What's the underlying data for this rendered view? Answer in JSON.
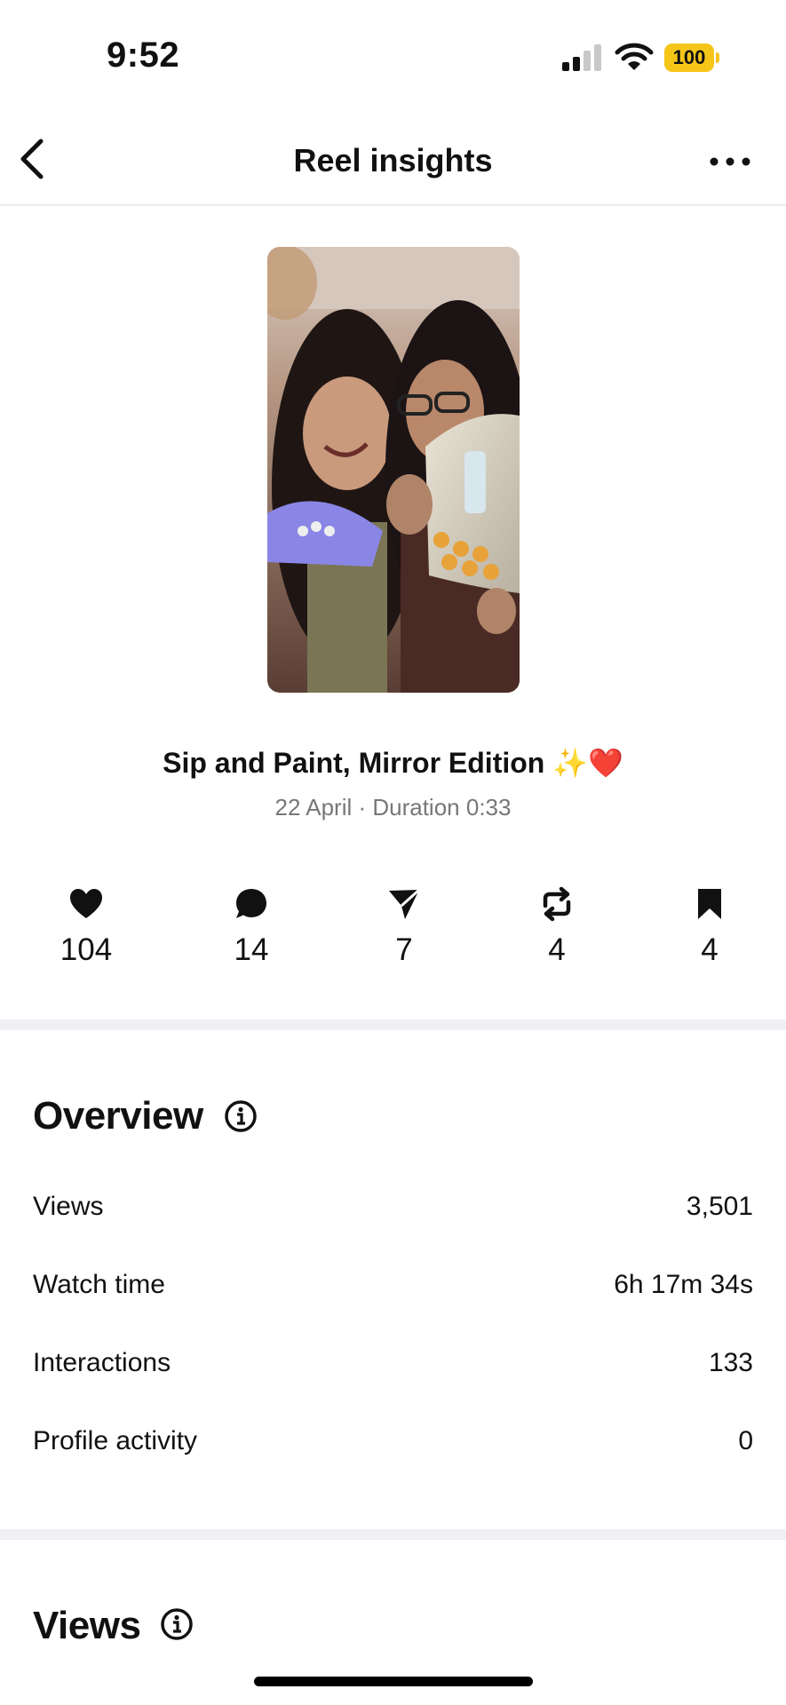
{
  "status_bar": {
    "time": "9:52",
    "battery": "100"
  },
  "nav": {
    "title": "Reel insights"
  },
  "reel": {
    "caption": "Sip and Paint, Mirror Edition ✨❤️",
    "meta": "22 April · Duration 0:33"
  },
  "stats": [
    {
      "icon": "heart-icon",
      "value": "104"
    },
    {
      "icon": "comment-icon",
      "value": "14"
    },
    {
      "icon": "share-icon",
      "value": "7"
    },
    {
      "icon": "repost-icon",
      "value": "4"
    },
    {
      "icon": "bookmark-icon",
      "value": "4"
    }
  ],
  "overview": {
    "title": "Overview",
    "rows": [
      {
        "label": "Views",
        "value": "3,501"
      },
      {
        "label": "Watch time",
        "value": "6h 17m 34s"
      },
      {
        "label": "Interactions",
        "value": "133"
      },
      {
        "label": "Profile activity",
        "value": "0"
      }
    ]
  },
  "views_section": {
    "title": "Views"
  },
  "colors": {
    "battery": "#f5c518",
    "divider": "#efeff4",
    "meta_text": "#777777"
  }
}
